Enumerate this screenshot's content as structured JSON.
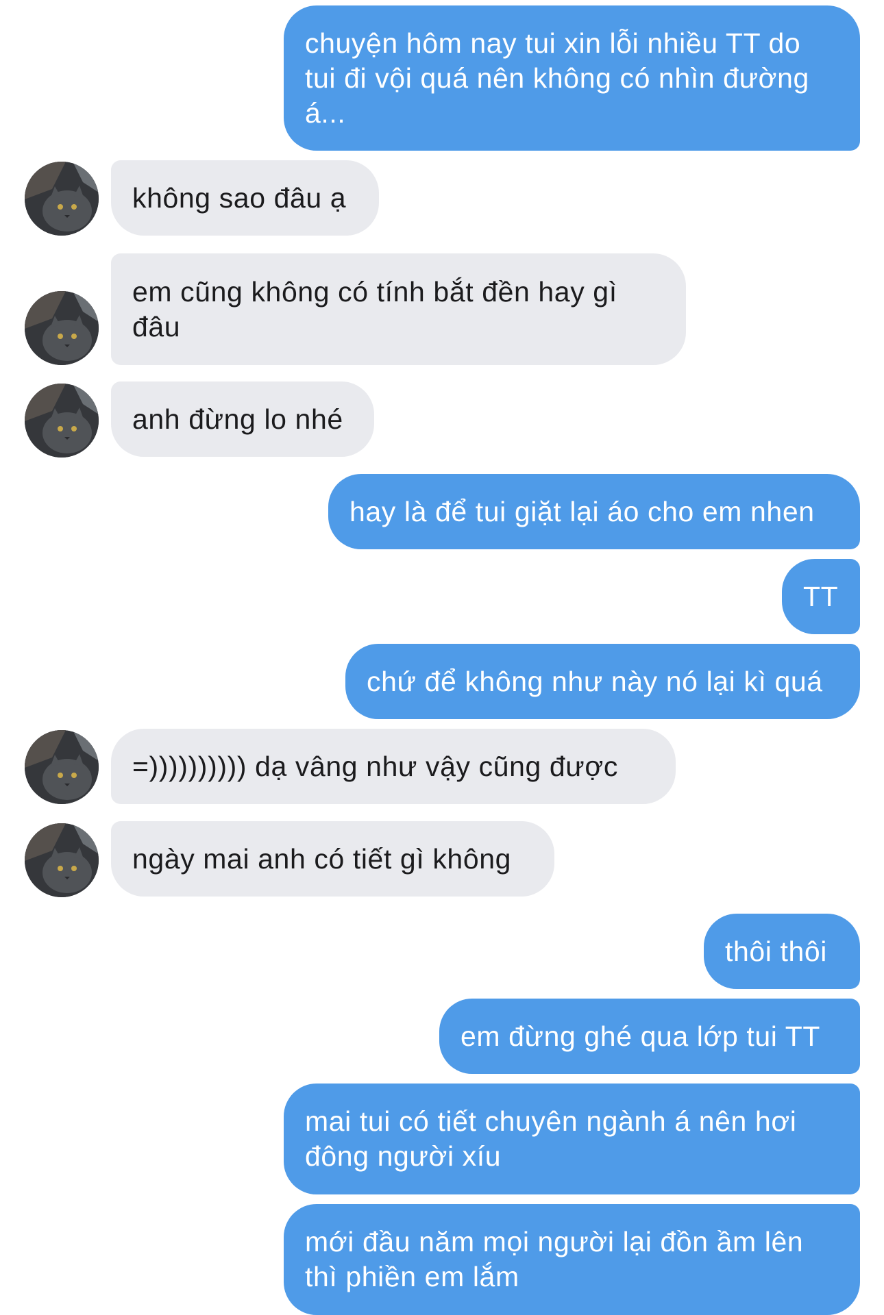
{
  "conversation": {
    "messages": [
      {
        "text": "chuyện hôm nay tui xin lỗi nhiều TT do tui đi vội quá nên không có nhìn đường á..."
      },
      {
        "text": "không sao đâu ạ"
      },
      {
        "text": "em cũng không có tính bắt đền hay gì đâu"
      },
      {
        "text": "anh đừng lo nhé"
      },
      {
        "text": "hay là để tui giặt lại áo cho em nhen"
      },
      {
        "text": "TT"
      },
      {
        "text": "chứ để không như này nó lại kì quá"
      },
      {
        "text": "=)))))))))) dạ vâng như vậy cũng được"
      },
      {
        "text": "ngày mai anh có tiết gì không"
      },
      {
        "text": "thôi thôi"
      },
      {
        "text": "em đừng ghé qua lớp tui TT"
      },
      {
        "text": "mai tui có tiết chuyên ngành á nên hơi đông người xíu"
      },
      {
        "text": "mới đầu năm mọi người lại đồn ầm lên thì phiền em lắm"
      }
    ]
  },
  "theme": {
    "outgoing_bubble_color": "#4f9be8",
    "incoming_bubble_color": "#e9eaee",
    "avatar_icon": "contact-avatar-cat-photo"
  }
}
